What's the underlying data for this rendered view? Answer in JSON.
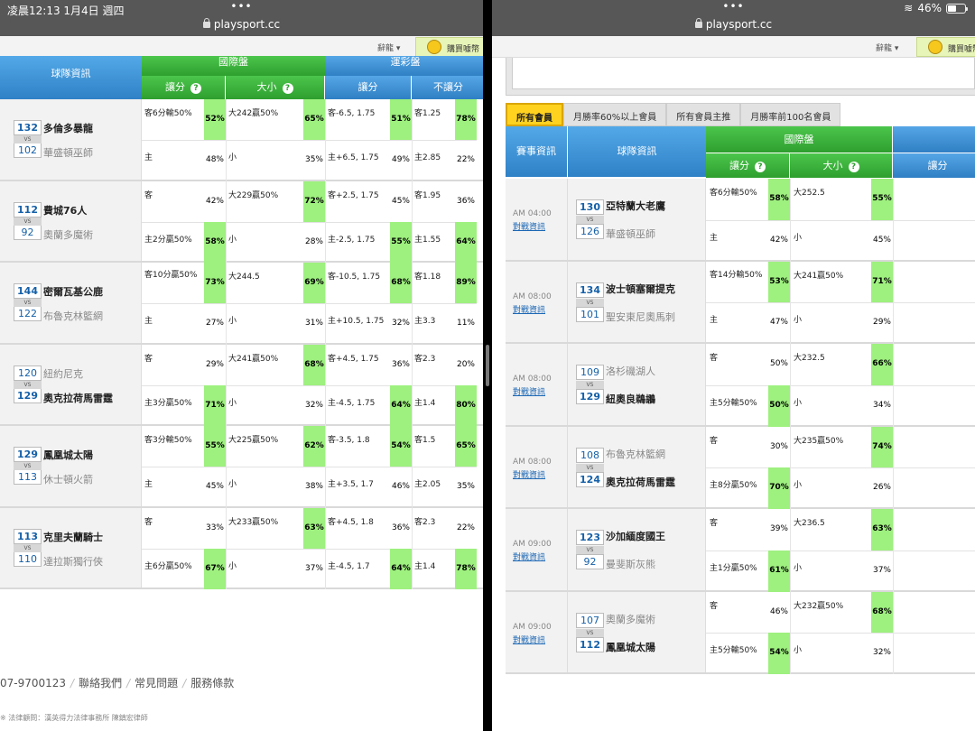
{
  "status": {
    "time": "凌晨12:13   1月4日 週四",
    "url": "playsport.cc",
    "battery": "46%",
    "dots": "•••"
  },
  "topbar": {
    "lang_label": "辭龍 ▾",
    "buy_label": "購買噱幣"
  },
  "headers": {
    "team_info": "球隊資訊",
    "event_info": "賽事資訊",
    "intl": "國際盤",
    "lottery": "運彩盤",
    "spread": "讓分",
    "total": "大小",
    "no_spread": "不讓分",
    "help": "?"
  },
  "filters": [
    "所有會員",
    "月勝率60%以上會員",
    "所有會員主推",
    "月勝率前100名會員"
  ],
  "left_games": [
    {
      "teams": [
        {
          "score": "132",
          "name": "多倫多暴龍",
          "win": true
        },
        {
          "score": "102",
          "name": "華盛頓巫師",
          "win": false
        }
      ],
      "rows": [
        {
          "spread": "客6分輸50%",
          "sp_pct": "52%",
          "sp_hi": true,
          "total": "大242贏50%",
          "to_pct": "65%",
          "to_hi": true,
          "lot": "客-6.5, 1.75",
          "lot_pct": "51%",
          "lot_hi": true,
          "ml": "客1.25",
          "ml_pct": "78%",
          "ml_hi": true
        },
        {
          "spread": "主",
          "sp_pct": "48%",
          "sp_hi": false,
          "total": "小",
          "to_pct": "35%",
          "to_hi": false,
          "lot": "主+6.5, 1.75",
          "lot_pct": "49%",
          "lot_hi": false,
          "ml": "主2.85",
          "ml_pct": "22%",
          "ml_hi": false
        }
      ]
    },
    {
      "teams": [
        {
          "score": "112",
          "name": "費城76人",
          "win": true
        },
        {
          "score": "92",
          "name": "奧蘭多魔術",
          "win": false
        }
      ],
      "rows": [
        {
          "spread": "客",
          "sp_pct": "42%",
          "sp_hi": false,
          "total": "大229贏50%",
          "to_pct": "72%",
          "to_hi": true,
          "lot": "客+2.5, 1.75",
          "lot_pct": "45%",
          "lot_hi": false,
          "ml": "客1.95",
          "ml_pct": "36%",
          "ml_hi": false
        },
        {
          "spread": "主2分贏50%",
          "sp_pct": "58%",
          "sp_hi": true,
          "total": "小",
          "to_pct": "28%",
          "to_hi": false,
          "lot": "主-2.5, 1.75",
          "lot_pct": "55%",
          "lot_hi": true,
          "ml": "主1.55",
          "ml_pct": "64%",
          "ml_hi": true
        }
      ]
    },
    {
      "teams": [
        {
          "score": "144",
          "name": "密爾瓦基公鹿",
          "win": true
        },
        {
          "score": "122",
          "name": "布魯克林籃網",
          "win": false
        }
      ],
      "rows": [
        {
          "spread": "客10分贏50%",
          "sp_pct": "73%",
          "sp_hi": true,
          "total": "大244.5",
          "to_pct": "69%",
          "to_hi": true,
          "lot": "客-10.5, 1.75",
          "lot_pct": "68%",
          "lot_hi": true,
          "ml": "客1.18",
          "ml_pct": "89%",
          "ml_hi": true
        },
        {
          "spread": "主",
          "sp_pct": "27%",
          "sp_hi": false,
          "total": "小",
          "to_pct": "31%",
          "to_hi": false,
          "lot": "主+10.5, 1.75",
          "lot_pct": "32%",
          "lot_hi": false,
          "ml": "主3.3",
          "ml_pct": "11%",
          "ml_hi": false
        }
      ]
    },
    {
      "teams": [
        {
          "score": "120",
          "name": "紐約尼克",
          "win": false
        },
        {
          "score": "129",
          "name": "奧克拉荷馬雷霆",
          "win": true
        }
      ],
      "rows": [
        {
          "spread": "客",
          "sp_pct": "29%",
          "sp_hi": false,
          "total": "大241贏50%",
          "to_pct": "68%",
          "to_hi": true,
          "lot": "客+4.5, 1.75",
          "lot_pct": "36%",
          "lot_hi": false,
          "ml": "客2.3",
          "ml_pct": "20%",
          "ml_hi": false
        },
        {
          "spread": "主3分贏50%",
          "sp_pct": "71%",
          "sp_hi": true,
          "total": "小",
          "to_pct": "32%",
          "to_hi": false,
          "lot": "主-4.5, 1.75",
          "lot_pct": "64%",
          "lot_hi": true,
          "ml": "主1.4",
          "ml_pct": "80%",
          "ml_hi": true
        }
      ]
    },
    {
      "teams": [
        {
          "score": "129",
          "name": "鳳凰城太陽",
          "win": true
        },
        {
          "score": "113",
          "name": "休士頓火箭",
          "win": false
        }
      ],
      "rows": [
        {
          "spread": "客3分輸50%",
          "sp_pct": "55%",
          "sp_hi": true,
          "total": "大225贏50%",
          "to_pct": "62%",
          "to_hi": true,
          "lot": "客-3.5, 1.8",
          "lot_pct": "54%",
          "lot_hi": true,
          "ml": "客1.5",
          "ml_pct": "65%",
          "ml_hi": true
        },
        {
          "spread": "主",
          "sp_pct": "45%",
          "sp_hi": false,
          "total": "小",
          "to_pct": "38%",
          "to_hi": false,
          "lot": "主+3.5, 1.7",
          "lot_pct": "46%",
          "lot_hi": false,
          "ml": "主2.05",
          "ml_pct": "35%",
          "ml_hi": false
        }
      ]
    },
    {
      "teams": [
        {
          "score": "113",
          "name": "克里夫蘭騎士",
          "win": true
        },
        {
          "score": "110",
          "name": "達拉斯獨行俠",
          "win": false
        }
      ],
      "rows": [
        {
          "spread": "客",
          "sp_pct": "33%",
          "sp_hi": false,
          "total": "大233贏50%",
          "to_pct": "63%",
          "to_hi": true,
          "lot": "客+4.5, 1.8",
          "lot_pct": "36%",
          "lot_hi": false,
          "ml": "客2.3",
          "ml_pct": "22%",
          "ml_hi": false
        },
        {
          "spread": "主6分贏50%",
          "sp_pct": "67%",
          "sp_hi": true,
          "total": "小",
          "to_pct": "37%",
          "to_hi": false,
          "lot": "主-4.5, 1.7",
          "lot_pct": "64%",
          "lot_hi": true,
          "ml": "主1.4",
          "ml_pct": "78%",
          "ml_hi": true
        }
      ]
    }
  ],
  "right_games": [
    {
      "time": "AM 04:00",
      "link": "對戰資訊",
      "teams": [
        {
          "score": "130",
          "name": "亞特蘭大老鷹",
          "win": true
        },
        {
          "score": "126",
          "name": "華盛頓巫師",
          "win": false
        }
      ],
      "rows": [
        {
          "spread": "客6分輸50%",
          "sp_pct": "58%",
          "sp_hi": true,
          "total": "大252.5",
          "to_pct": "55%",
          "to_hi": true
        },
        {
          "spread": "主",
          "sp_pct": "42%",
          "sp_hi": false,
          "total": "小",
          "to_pct": "45%",
          "to_hi": false
        }
      ]
    },
    {
      "time": "AM 08:00",
      "link": "對戰資訊",
      "teams": [
        {
          "score": "134",
          "name": "波士頓塞爾提克",
          "win": true
        },
        {
          "score": "101",
          "name": "聖安東尼奧馬刺",
          "win": false
        }
      ],
      "rows": [
        {
          "spread": "客14分輸50%",
          "sp_pct": "53%",
          "sp_hi": true,
          "total": "大241贏50%",
          "to_pct": "71%",
          "to_hi": true
        },
        {
          "spread": "主",
          "sp_pct": "47%",
          "sp_hi": false,
          "total": "小",
          "to_pct": "29%",
          "to_hi": false
        }
      ]
    },
    {
      "time": "AM 08:00",
      "link": "對戰資訊",
      "teams": [
        {
          "score": "109",
          "name": "洛杉磯湖人",
          "win": false
        },
        {
          "score": "129",
          "name": "紐奧良鵜鶘",
          "win": true
        }
      ],
      "rows": [
        {
          "spread": "客",
          "sp_pct": "50%",
          "sp_hi": false,
          "total": "大232.5",
          "to_pct": "66%",
          "to_hi": true
        },
        {
          "spread": "主5分輸50%",
          "sp_pct": "50%",
          "sp_hi": true,
          "total": "小",
          "to_pct": "34%",
          "to_hi": false
        }
      ]
    },
    {
      "time": "AM 08:00",
      "link": "對戰資訊",
      "teams": [
        {
          "score": "108",
          "name": "布魯克林籃網",
          "win": false
        },
        {
          "score": "124",
          "name": "奧克拉荷馬雷霆",
          "win": true
        }
      ],
      "rows": [
        {
          "spread": "客",
          "sp_pct": "30%",
          "sp_hi": false,
          "total": "大235贏50%",
          "to_pct": "74%",
          "to_hi": true
        },
        {
          "spread": "主8分贏50%",
          "sp_pct": "70%",
          "sp_hi": true,
          "total": "小",
          "to_pct": "26%",
          "to_hi": false
        }
      ]
    },
    {
      "time": "AM 09:00",
      "link": "對戰資訊",
      "teams": [
        {
          "score": "123",
          "name": "沙加緬度國王",
          "win": true
        },
        {
          "score": "92",
          "name": "曼斐斯灰熊",
          "win": false
        }
      ],
      "rows": [
        {
          "spread": "客",
          "sp_pct": "39%",
          "sp_hi": false,
          "total": "大236.5",
          "to_pct": "63%",
          "to_hi": true
        },
        {
          "spread": "主1分贏50%",
          "sp_pct": "61%",
          "sp_hi": true,
          "total": "小",
          "to_pct": "37%",
          "to_hi": false
        }
      ]
    },
    {
      "time": "AM 09:00",
      "link": "對戰資訊",
      "teams": [
        {
          "score": "107",
          "name": "奧蘭多魔術",
          "win": false
        },
        {
          "score": "112",
          "name": "鳳凰城太陽",
          "win": true
        }
      ],
      "rows": [
        {
          "spread": "客",
          "sp_pct": "46%",
          "sp_hi": false,
          "total": "大232贏50%",
          "to_pct": "68%",
          "to_hi": true
        },
        {
          "spread": "主5分輸50%",
          "sp_pct": "54%",
          "sp_hi": true,
          "total": "小",
          "to_pct": "32%",
          "to_hi": false
        }
      ]
    }
  ],
  "footer": {
    "phone": "07-9700123",
    "links": [
      "聯絡我們",
      "常見問題",
      "服務條款"
    ],
    "legal": "※ 法律顧問：漢英得力法律事務所 陳鎮宏律師"
  }
}
